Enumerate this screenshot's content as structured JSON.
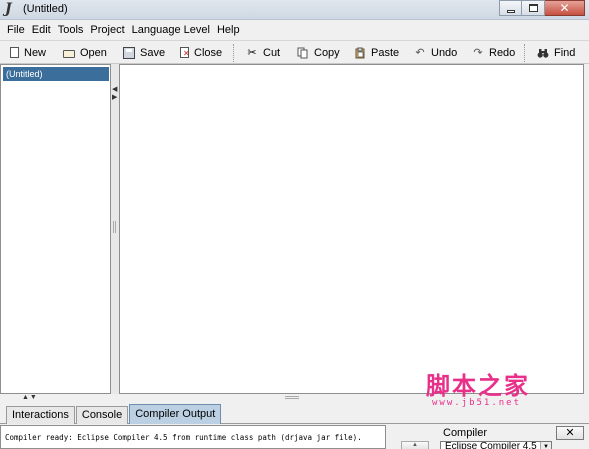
{
  "window": {
    "title": "(Untitled)",
    "app_icon_glyph": "J",
    "controls": [
      "minimize-icon",
      "maximize-icon",
      "close-icon"
    ],
    "close_glyph": "✕"
  },
  "menu": {
    "items": [
      "File",
      "Edit",
      "Tools",
      "Project",
      "Language Level",
      "Help"
    ]
  },
  "toolbar": {
    "new_label": "New",
    "open_label": "Open",
    "save_label": "Save",
    "close_label": "Close",
    "cut_label": "Cut",
    "copy_label": "Copy",
    "paste_label": "Paste",
    "undo_label": "Undo",
    "redo_label": "Redo",
    "find_label": "Find",
    "cut_glyph": "✂",
    "undo_glyph": "↶",
    "redo_glyph": "↷",
    "find_glyph": "⚲"
  },
  "documents": {
    "items": [
      "(Untitled)"
    ],
    "selected_color": "#3b6e9b"
  },
  "bottom_tabs": {
    "interactions": "Interactions",
    "console": "Console",
    "compiler_output": "Compiler Output",
    "active": "Compiler Output"
  },
  "output": {
    "text": "Compiler ready: Eclipse Compiler 4.5 from runtime class path (drjava jar file)."
  },
  "compiler_panel": {
    "label": "Compiler",
    "selected": "Eclipse Compiler 4.5",
    "close_glyph": "✕"
  },
  "watermark": {
    "main": "脚本之家",
    "sub": "www.jb51.net",
    "color": "#e8308a"
  }
}
